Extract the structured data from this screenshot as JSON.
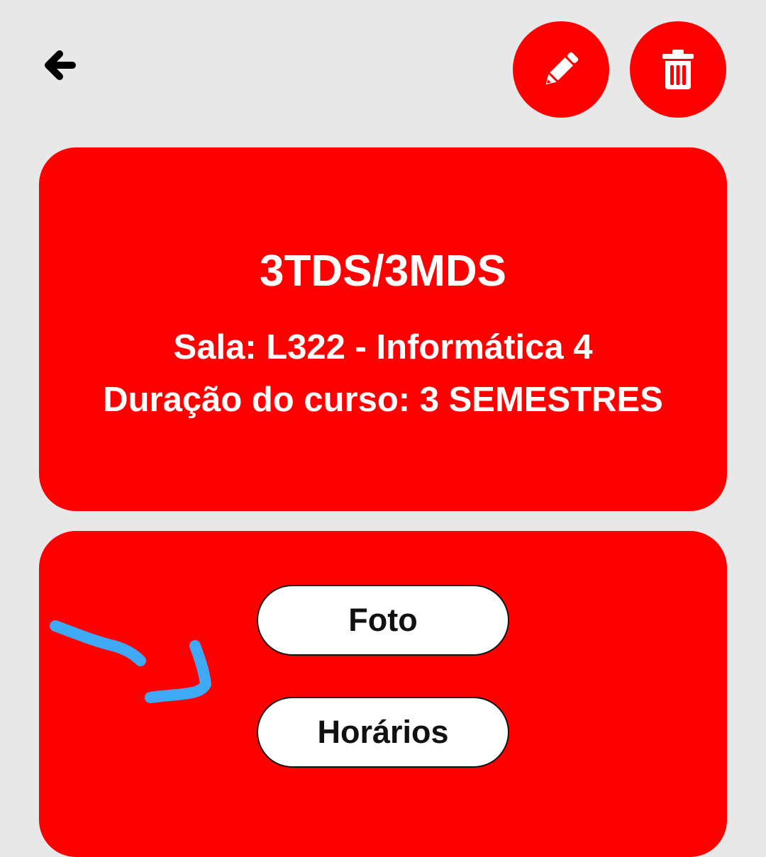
{
  "header": {
    "back_icon": "arrow-left-icon",
    "edit_icon": "pencil-icon",
    "delete_icon": "trash-icon"
  },
  "course": {
    "title": "3TDS/3MDS",
    "room": "Sala: L322 - Informática 4",
    "duration": "Duração do curso: 3 SEMESTRES"
  },
  "actions": {
    "photo_label": "Foto",
    "schedule_label": "Horários"
  },
  "colors": {
    "accent": "#ff0000",
    "background": "#e8e8e8",
    "text_on_accent": "#ffffff",
    "annotation": "#3fa9f5"
  }
}
